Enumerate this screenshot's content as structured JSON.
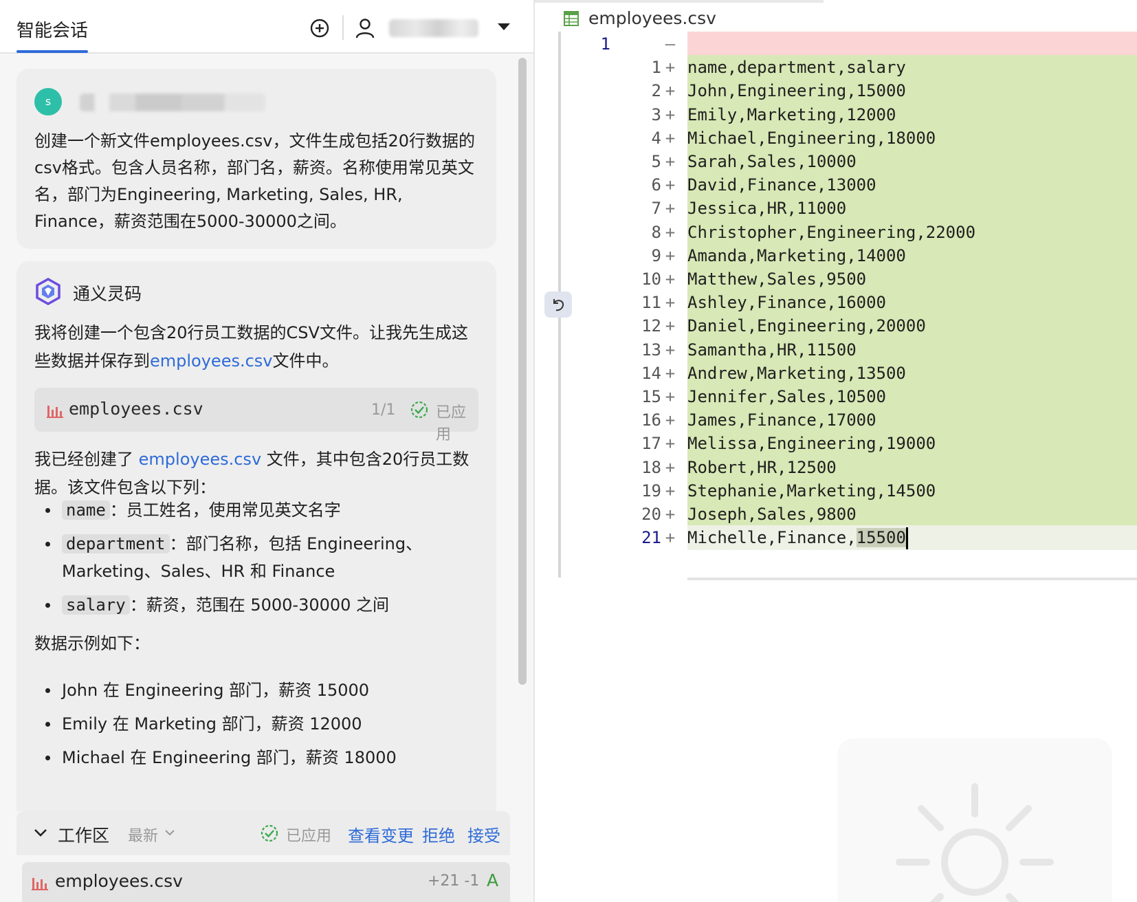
{
  "left_panel": {
    "tab_title": "智能会话",
    "user_message": {
      "avatar_letter": "s",
      "text": "创建一个新文件employees.csv，文件生成包括20行数据的csv格式。包含人员名称，部门名，薪资。名称使用常见英文名，部门为Engineering, Marketing, Sales, HR, Finance，薪资范围在5000-30000之间。"
    },
    "ai_message": {
      "assistant_name": "通义灵码",
      "p1_before": "我将创建一个包含20行员工数据的CSV文件。让我先生成这些数据并保存到",
      "p1_link": "employees.csv",
      "p1_after": "文件中。",
      "file_chip": {
        "name": "employees.csv",
        "count": "1/1",
        "status": "已应用"
      },
      "p2_before": "我已经创建了 ",
      "p2_link": "employees.csv",
      "p2_after": " 文件，其中包含20行员工数据。该文件包含以下列：",
      "columns": [
        {
          "code": "name",
          "desc": "：员工姓名，使用常见英文名字"
        },
        {
          "code": "department",
          "desc": "：部门名称，包括 Engineering、Marketing、Sales、HR 和 Finance"
        },
        {
          "code": "salary",
          "desc": "：薪资，范围在 5000-30000 之间"
        }
      ],
      "p3": "数据示例如下：",
      "examples": [
        "John 在 Engineering 部门，薪资 15000",
        "Emily 在 Marketing 部门，薪资 12000",
        "Michael 在 Engineering 部门，薪资 18000"
      ]
    },
    "workspace": {
      "label": "工作区",
      "sort": "最新",
      "status": "已应用",
      "view_changes": "查看变更",
      "reject": "拒绝",
      "accept": "接受"
    },
    "file_row": {
      "name": "employees.csv",
      "diff": "+21 -1",
      "status": "A"
    }
  },
  "editor": {
    "file_name": "employees.csv",
    "deleted_line": {
      "old_number": "1",
      "mark": "—"
    },
    "lines": [
      "name,department,salary",
      "John,Engineering,15000",
      "Emily,Marketing,12000",
      "Michael,Engineering,18000",
      "Sarah,Sales,10000",
      "David,Finance,13000",
      "Jessica,HR,11000",
      "Christopher,Engineering,22000",
      "Amanda,Marketing,14000",
      "Matthew,Sales,9500",
      "Ashley,Finance,16000",
      "Daniel,Engineering,20000",
      "Samantha,HR,11500",
      "Andrew,Marketing,13500",
      "Jennifer,Sales,10500",
      "James,Finance,17000",
      "Melissa,Engineering,19000",
      "Robert,HR,12500",
      "Stephanie,Marketing,14500",
      "Joseph,Sales,9800"
    ],
    "last_line": {
      "prefix": "Michelle,Finance,",
      "selected": "15500"
    },
    "add_mark": "+"
  }
}
